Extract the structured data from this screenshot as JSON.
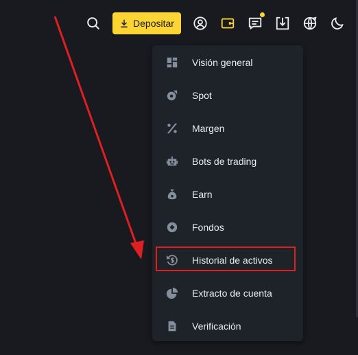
{
  "header": {
    "deposit_label": "Depositar",
    "icons": [
      "search-icon",
      "download-icon",
      "user-icon",
      "wallet-icon",
      "message-icon",
      "app-download-icon",
      "globe-icon",
      "moon-icon"
    ]
  },
  "wallet_menu": {
    "items": [
      {
        "label": "Visión general",
        "icon": "grid-icon"
      },
      {
        "label": "Spot",
        "icon": "spot-icon"
      },
      {
        "label": "Margen",
        "icon": "percent-icon"
      },
      {
        "label": "Bots de trading",
        "icon": "robot-icon"
      },
      {
        "label": "Earn",
        "icon": "money-bag-icon"
      },
      {
        "label": "Fondos",
        "icon": "coin-icon"
      },
      {
        "label": "Historial de activos",
        "icon": "dollar-history-icon"
      },
      {
        "label": "Extracto de cuenta",
        "icon": "pie-chart-icon"
      },
      {
        "label": "Verificación",
        "icon": "document-icon"
      }
    ],
    "highlighted_item": "Historial de activos"
  },
  "colors": {
    "background": "#181a20",
    "menu_background": "#1e2329",
    "accent": "#fcd535",
    "annotation": "#e02020",
    "icon": "#848e9c",
    "text": "#eaecef"
  }
}
